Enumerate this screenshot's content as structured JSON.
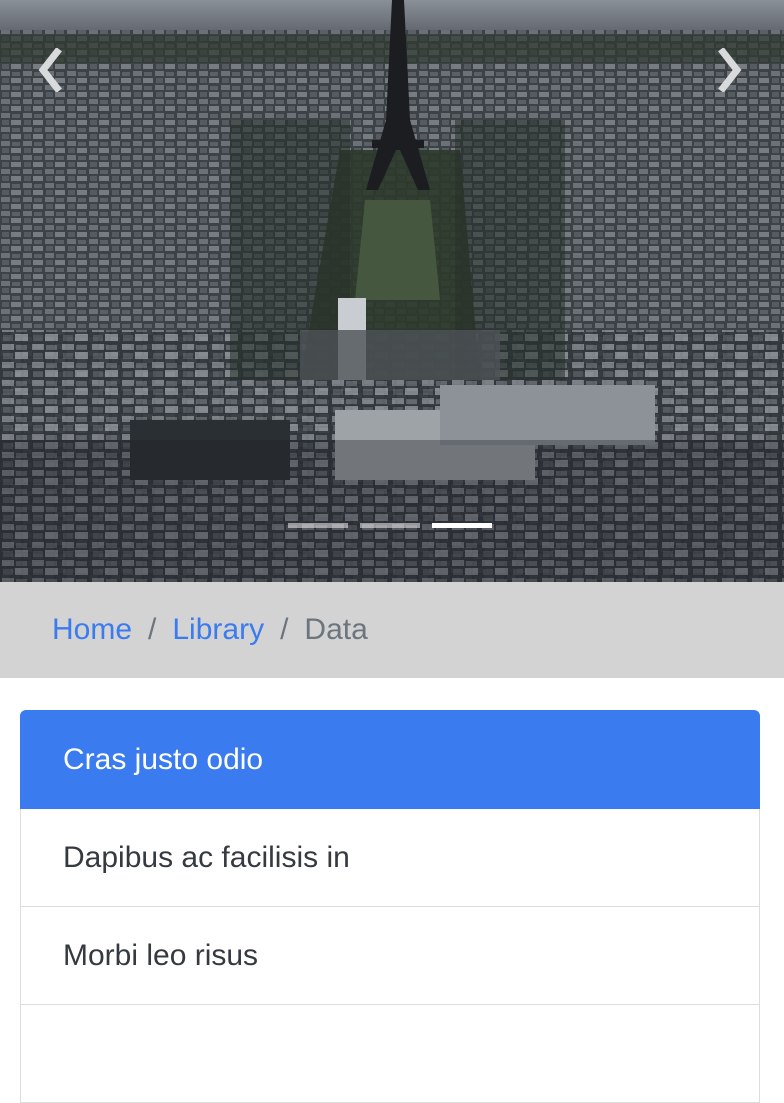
{
  "carousel": {
    "image_alt": "Aerial view of Paris with the Eiffel Tower",
    "prev_icon": "chevron-left-icon",
    "next_icon": "chevron-right-icon",
    "slide_count": 3,
    "active_slide": 3
  },
  "breadcrumb": {
    "items": [
      "Home",
      "Library"
    ],
    "separator": "/",
    "active": "Data"
  },
  "list": {
    "items": [
      "Cras justo odio",
      "Dapibus ac facilisis in",
      "Morbi leo risus",
      ""
    ],
    "active_index": 0
  },
  "colors": {
    "primary": "#3a7bef",
    "breadcrumb_bg": "#d3d3d3",
    "muted": "#6c757d"
  }
}
